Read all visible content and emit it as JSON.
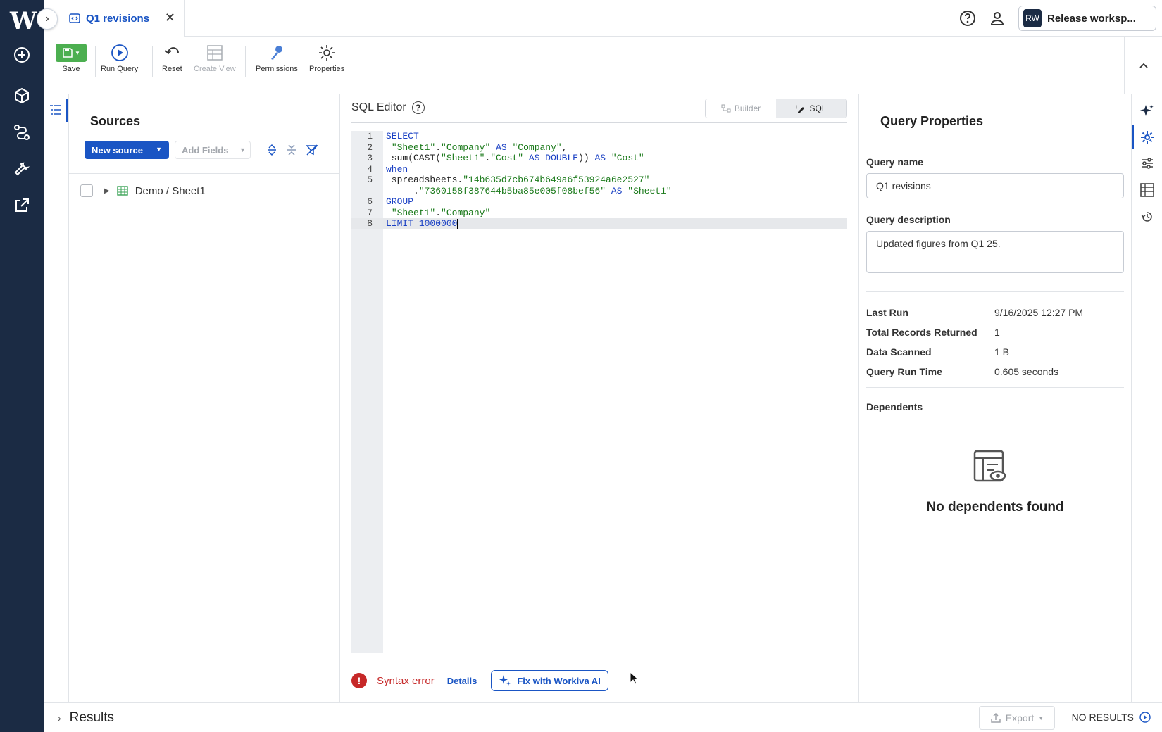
{
  "app": {
    "logo": "W"
  },
  "tab": {
    "title": "Q1 revisions"
  },
  "header": {
    "workspace_initials": "RW",
    "workspace_label": "Release worksp..."
  },
  "toolbar": {
    "save": "Save",
    "run_query": "Run Query",
    "reset": "Reset",
    "create_view": "Create View",
    "permissions": "Permissions",
    "properties": "Properties"
  },
  "sources": {
    "title": "Sources",
    "new_source": "New source",
    "add_fields": "Add Fields",
    "tree_item": "Demo / Sheet1"
  },
  "editor": {
    "title": "SQL Editor",
    "mode_builder": "Builder",
    "mode_sql": "SQL",
    "line_numbers": [
      "1",
      "2",
      "3",
      "4",
      "5",
      "",
      "6",
      "7",
      "8"
    ],
    "error_text": "Syntax error",
    "details_label": "Details",
    "fix_label": "Fix with Workiva AI"
  },
  "properties": {
    "title": "Query Properties",
    "name_label": "Query name",
    "name_value": "Q1 revisions",
    "description_label": "Query description",
    "description_value": "Updated figures from Q1 25.",
    "stats": [
      {
        "label": "Last Run",
        "value": "9/16/2025 12:27 PM"
      },
      {
        "label": "Total Records Returned",
        "value": "1"
      },
      {
        "label": "Data Scanned",
        "value": "1 B"
      },
      {
        "label": "Query Run Time",
        "value": "0.605 seconds"
      }
    ],
    "dependents_label": "Dependents",
    "no_dependents": "No dependents found"
  },
  "results": {
    "title": "Results",
    "export": "Export",
    "status": "NO RESULTS"
  },
  "colors": {
    "accent": "#1a55c4",
    "rail": "#1b2b44",
    "error": "#c62828",
    "save": "#4caf50"
  }
}
